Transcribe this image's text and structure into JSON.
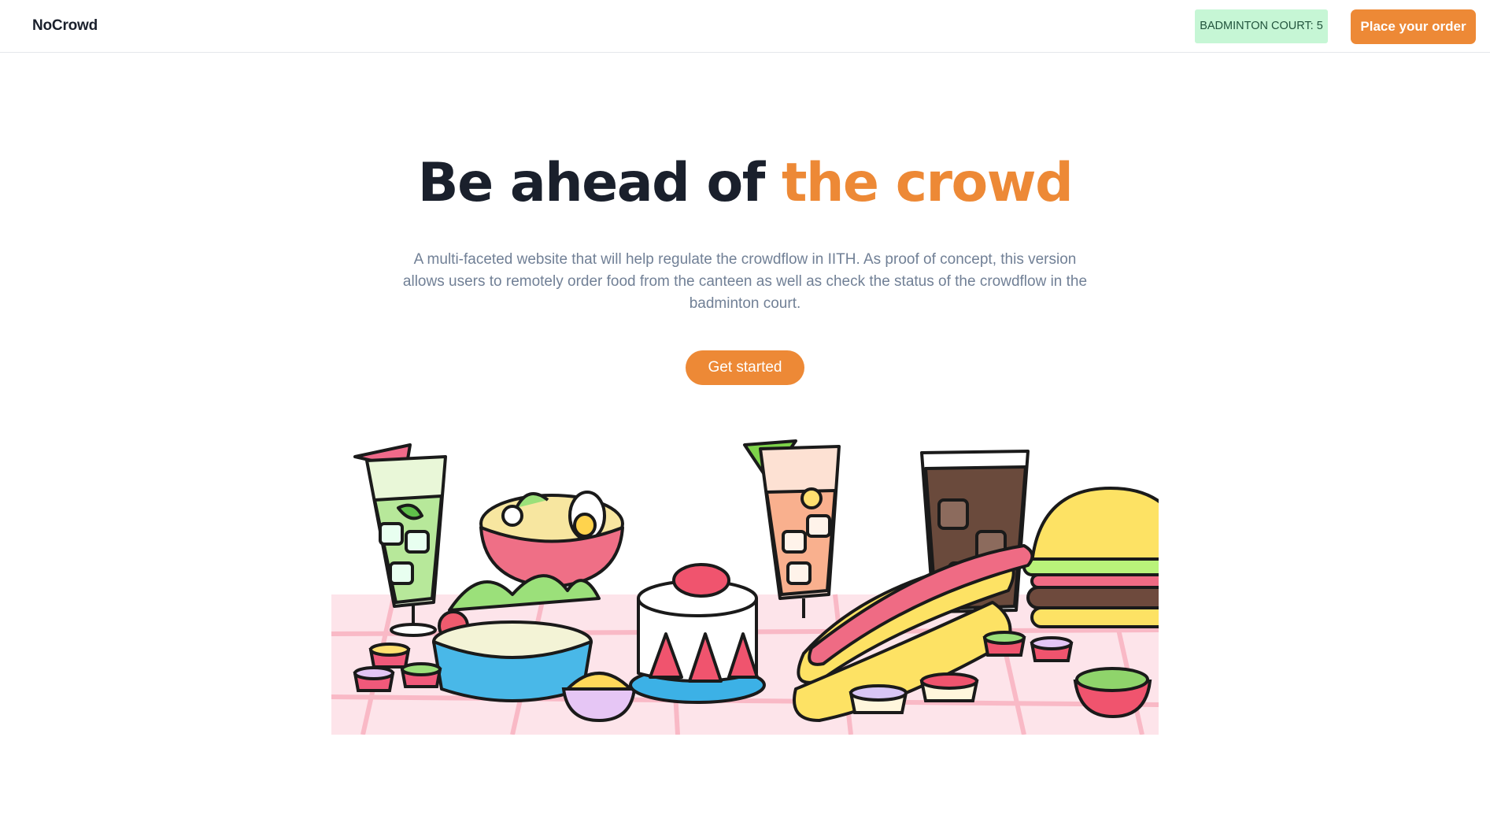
{
  "navbar": {
    "brand": "NoCrowd",
    "status_badge": "BADMINTON COURT: 5",
    "order_button": "Place your order"
  },
  "hero": {
    "title_main": "Be ahead of",
    "title_accent": "the crowd",
    "description": "A multi-faceted website that will help regulate the crowdflow in IITH. As proof of concept, this version allows users to remotely order food from the canteen as well as check the status of the crowdflow in the badminton court.",
    "cta_label": "Get started"
  },
  "colors": {
    "accent": "#ed8936",
    "heading": "#1a202c",
    "body_text": "#718096",
    "badge_bg": "#c6f6d5",
    "badge_text": "#22543d"
  },
  "illustration": {
    "items": [
      "drink-with-umbrella-icon",
      "ramen-bowl-icon",
      "salad-bowl-icon",
      "strawberry-cake-icon",
      "iced-tea-icon",
      "cola-glass-icon",
      "burger-icon",
      "hotdog-icon",
      "dip-cups-icon",
      "macaroni-bowl-icon",
      "peas-bowl-icon"
    ]
  }
}
